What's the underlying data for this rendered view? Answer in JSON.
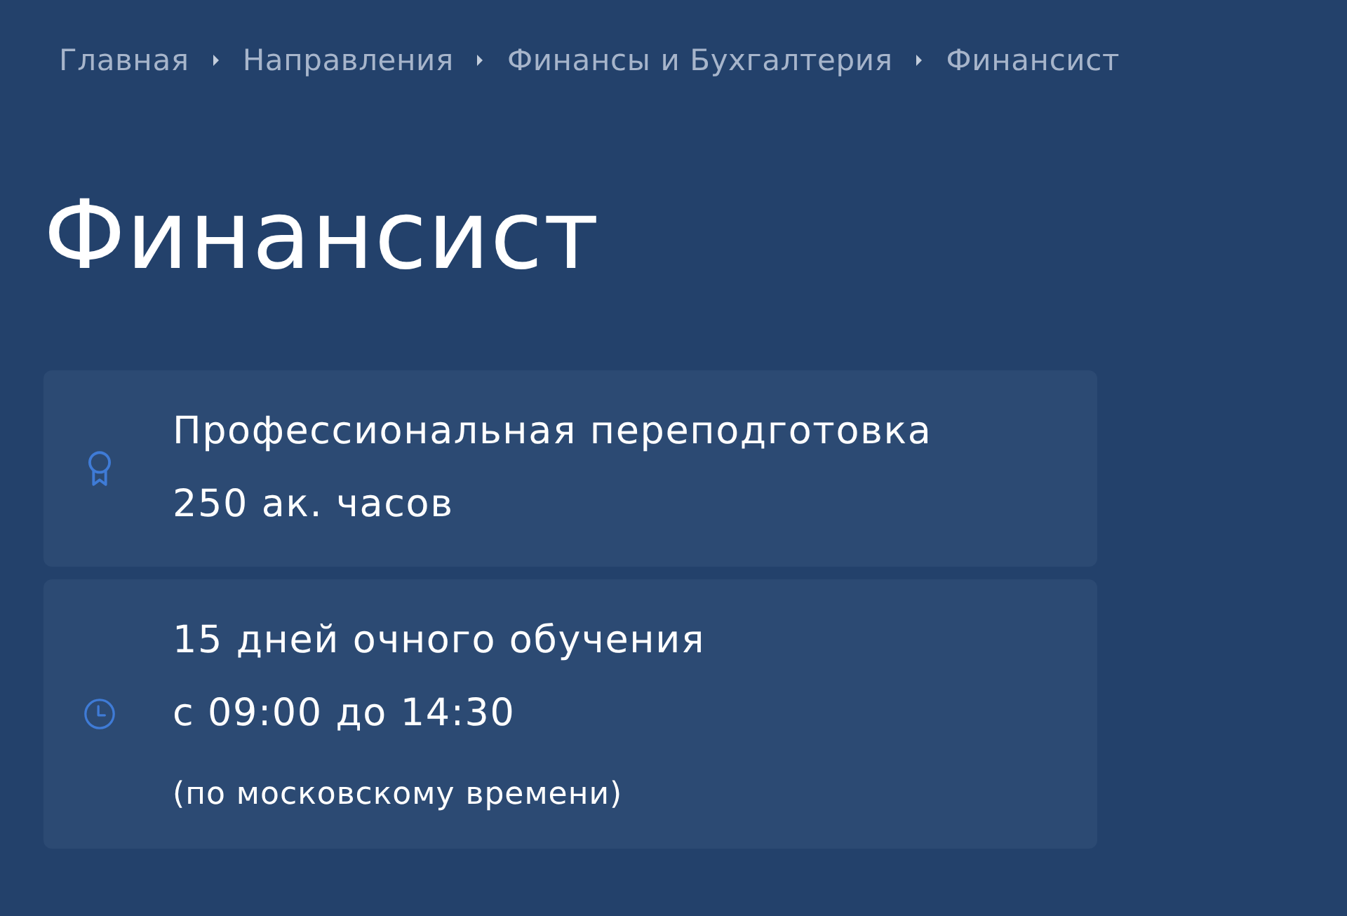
{
  "breadcrumbs": [
    {
      "label": "Главная"
    },
    {
      "label": "Направления"
    },
    {
      "label": "Финансы и Бухгалтерия"
    },
    {
      "label": "Финансист"
    }
  ],
  "title": "Финансист",
  "features": [
    {
      "kind": "award",
      "lines": [
        {
          "text": "Профессиональная переподготовка",
          "kind": "main"
        },
        {
          "text": "250 ак. часов",
          "kind": "main"
        }
      ]
    },
    {
      "kind": "schedule",
      "lines": [
        {
          "text": "15 дней очного обучения",
          "kind": "main"
        },
        {
          "text": "с 09:00 до 14:30",
          "kind": "main"
        },
        {
          "text": "(по московскому времени)",
          "kind": "note"
        }
      ]
    }
  ]
}
